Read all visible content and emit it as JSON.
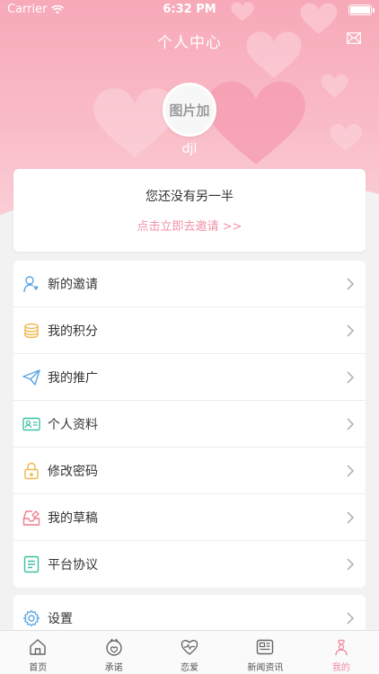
{
  "status_bar": {
    "carrier": "Carrier",
    "time": "6:32 PM"
  },
  "nav": {
    "title": "个人中心"
  },
  "profile": {
    "avatar_text": "图片加",
    "username": "djl"
  },
  "partner": {
    "message": "您还没有另一半",
    "invite_link": "点击立即去邀请 >>"
  },
  "menu": {
    "items": [
      {
        "label": "新的邀请",
        "icon": "person-add-icon"
      },
      {
        "label": "我的积分",
        "icon": "coins-icon"
      },
      {
        "label": "我的推广",
        "icon": "paper-plane-icon"
      },
      {
        "label": "个人资料",
        "icon": "id-card-icon"
      },
      {
        "label": "修改密码",
        "icon": "lock-icon"
      },
      {
        "label": "我的草稿",
        "icon": "inbox-icon"
      },
      {
        "label": "平台协议",
        "icon": "document-icon"
      }
    ],
    "settings_label": "设置"
  },
  "tabbar": {
    "tabs": [
      {
        "label": "首页",
        "icon": "home-icon"
      },
      {
        "label": "承诺",
        "icon": "promise-icon"
      },
      {
        "label": "恋爱",
        "icon": "heart-icon"
      },
      {
        "label": "新闻资讯",
        "icon": "news-icon"
      },
      {
        "label": "我的",
        "icon": "profile-icon"
      }
    ],
    "active_index": 4
  },
  "colors": {
    "accent": "#f08aa0",
    "link": "#f191a6",
    "header": "#f7a9b8"
  }
}
